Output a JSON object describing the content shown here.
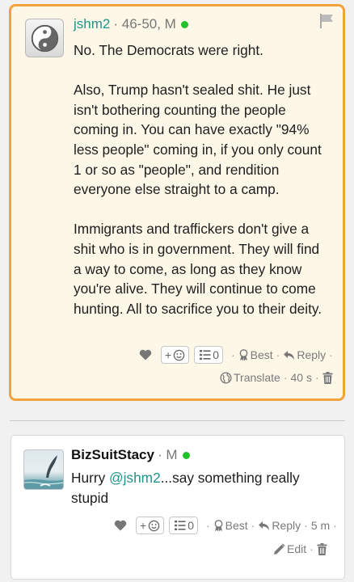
{
  "comments": [
    {
      "username": "jshm2",
      "meta": "· 46-50, M",
      "body": [
        "No. The Democrats were right.",
        "Also, Trump hasn't sealed shit. He just isn't bothering counting the people coming in. You can have exactly \"94% less people\" coming in, if you only count 1 or so as \"people\", and rendition everyone else straight to a camp.",
        "Immigrants and traffickers don't give a shit who is in government. They will find a way to come, as long as they know you're alive. They will continue to come hunting. All to sacrifice you to their deity."
      ],
      "reaction_add": "+",
      "list_count": "0",
      "best_label": "Best",
      "reply_label": "Reply",
      "translate_label": "Translate",
      "time": "40 s"
    },
    {
      "username": "BizSuitStacy",
      "meta": "· M",
      "body_pre": "Hurry ",
      "mention": "@jshm2",
      "body_post": "...say something really stupid",
      "reaction_add": "+",
      "list_count": "0",
      "best_label": "Best",
      "reply_label": "Reply",
      "time": "5 m",
      "edit_label": "Edit"
    }
  ],
  "colors": {
    "highlight_border": "#f3a33c",
    "username": "#22948a",
    "online": "#22c02b"
  }
}
